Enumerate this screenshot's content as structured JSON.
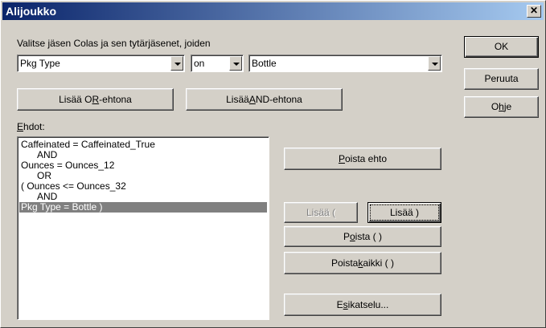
{
  "window": {
    "title": "Alijoukko",
    "close": "✕"
  },
  "instruction": "Valitse jäsen Colas ja sen tytärjäsenet, joiden",
  "filter": {
    "field": "Pkg Type",
    "operator": "on",
    "value": "Bottle"
  },
  "buttons": {
    "add_or": {
      "pre": "Lisää O",
      "key": "R",
      "post": "-ehtona"
    },
    "add_and": {
      "pre": "Lisää ",
      "key": "A",
      "post": "ND-ehtona"
    },
    "ok": "OK",
    "cancel": "Peruuta",
    "help": {
      "pre": "O",
      "key": "h",
      "post": "je"
    },
    "remove_condition": {
      "key": "P",
      "post": "oista ehto"
    },
    "add_open_paren": "Lisää (",
    "add_close_paren": "Lisää )",
    "remove_paren": {
      "pre": "P",
      "key": "o",
      "post": "ista (  )"
    },
    "remove_all": {
      "pre": "Poista ",
      "key": "k",
      "post": "aikki  (  )"
    },
    "preview": {
      "pre": "E",
      "key": "s",
      "post": "ikatselu..."
    }
  },
  "conditions_label": {
    "key": "E",
    "post": "hdot:"
  },
  "conditions": [
    {
      "text": "Caffeinated = Caffeinated_True",
      "indent": false,
      "selected": false
    },
    {
      "text": "AND",
      "indent": true,
      "selected": false
    },
    {
      "text": "Ounces = Ounces_12",
      "indent": false,
      "selected": false
    },
    {
      "text": "OR",
      "indent": true,
      "selected": false
    },
    {
      "text": "( Ounces <= Ounces_32",
      "indent": false,
      "selected": false
    },
    {
      "text": "AND",
      "indent": true,
      "selected": false
    },
    {
      "text": "Pkg Type = Bottle )",
      "indent": false,
      "selected": true
    }
  ]
}
